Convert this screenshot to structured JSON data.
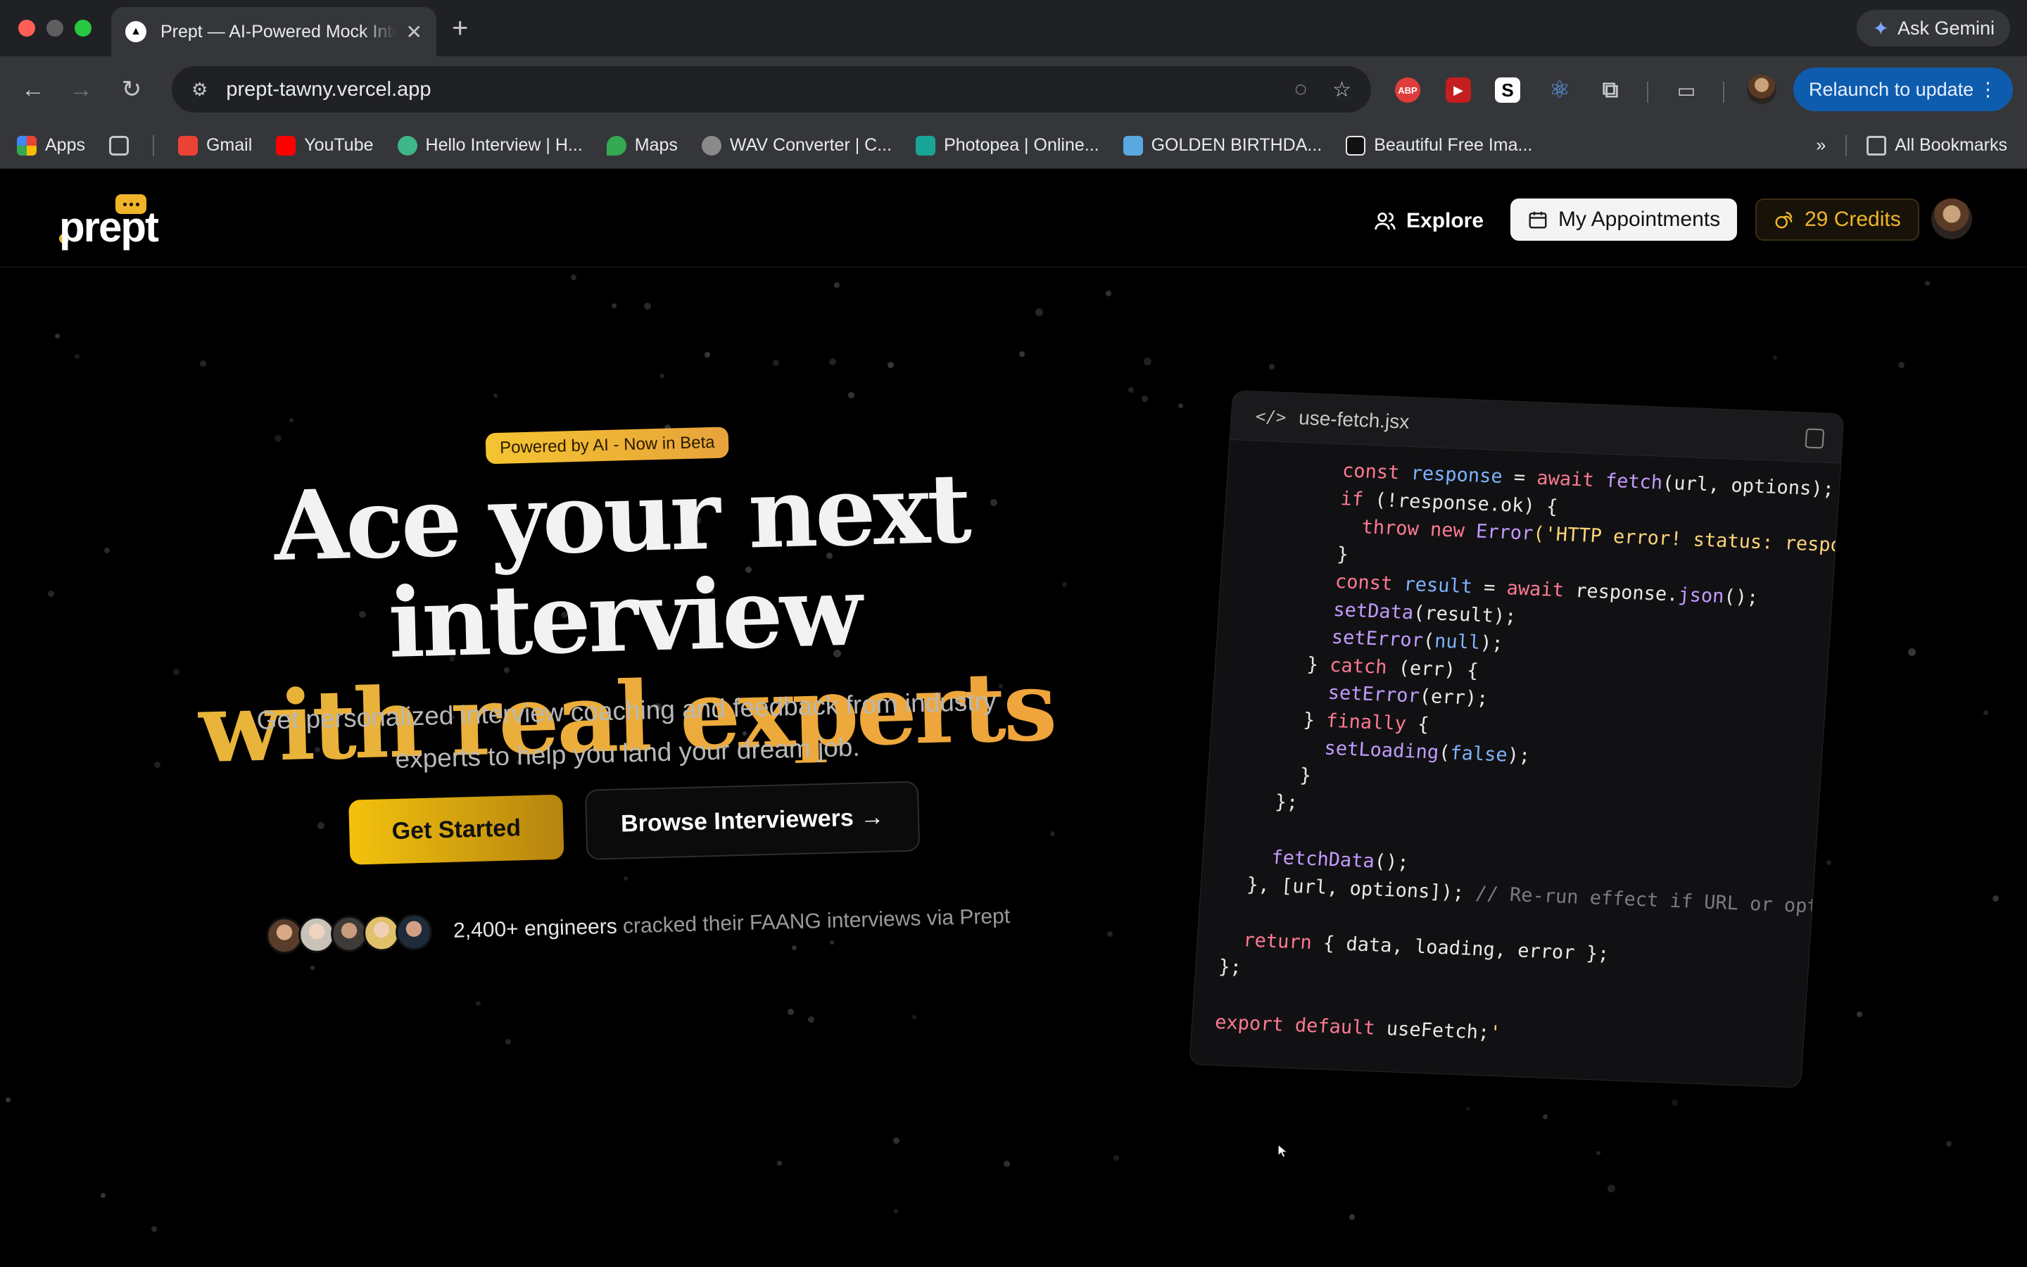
{
  "browser": {
    "tab_title": "Prept — AI-Powered Mock Interviews",
    "url": "prept-tawny.vercel.app",
    "ask_gemini": "Ask Gemini",
    "relaunch": "Relaunch to update",
    "bookmarks": [
      {
        "label": "Apps",
        "color": "#4285f4"
      },
      {
        "label": "Gmail",
        "color": "#ea4335"
      },
      {
        "label": "YouTube",
        "color": "#ff0000"
      },
      {
        "label": "Hello Interview | H...",
        "color": "#3fb58a"
      },
      {
        "label": "Maps",
        "color": "#34a853"
      },
      {
        "label": "WAV Converter | C...",
        "color": "#8a8a8a"
      },
      {
        "label": "Photopea | Online...",
        "color": "#18a497"
      },
      {
        "label": "GOLDEN BIRTHDA...",
        "color": "#5aa8e0"
      },
      {
        "label": "Beautiful Free Ima...",
        "color": "#111111"
      }
    ],
    "all_bookmarks": "All Bookmarks"
  },
  "nav": {
    "logo": "prept",
    "explore": "Explore",
    "appointments": "My Appointments",
    "credits": "29 Credits"
  },
  "hero": {
    "badge": "Powered by AI - Now in Beta",
    "headline_line1": "Ace your next interview",
    "headline_line2": "with real experts",
    "subtitle": "Get personalized interview coaching and feedback from industry experts to help you land your dream job.",
    "cta_primary": "Get Started",
    "cta_secondary": "Browse Interviewers →",
    "proof_strong": "2,400+ engineers",
    "proof_rest": "cracked their FAANG interviews via Prept"
  },
  "code": {
    "filename": "use-fetch.jsx",
    "lines": [
      [
        [
          "        ",
          ""
        ],
        [
          "const ",
          "kw"
        ],
        [
          "response",
          "var"
        ],
        [
          " = ",
          ""
        ],
        [
          "await ",
          "kw"
        ],
        [
          "fetch",
          "fn"
        ],
        [
          "(url, options);",
          ""
        ]
      ],
      [
        [
          "        ",
          ""
        ],
        [
          "if ",
          "kw"
        ],
        [
          "(!response.ok) {",
          ""
        ]
      ],
      [
        [
          "          ",
          ""
        ],
        [
          "throw new ",
          "kw"
        ],
        [
          "Error",
          "fn"
        ],
        [
          "('HTTP error! status: response",
          "str"
        ]
      ],
      [
        [
          "        }",
          ""
        ]
      ],
      [
        [
          "        ",
          ""
        ],
        [
          "const ",
          "kw"
        ],
        [
          "result",
          "var"
        ],
        [
          " = ",
          ""
        ],
        [
          "await ",
          "kw"
        ],
        [
          "response.",
          ""
        ],
        [
          "json",
          "fn"
        ],
        [
          "();",
          ""
        ]
      ],
      [
        [
          "        ",
          ""
        ],
        [
          "setData",
          "fn"
        ],
        [
          "(result);",
          ""
        ]
      ],
      [
        [
          "        ",
          ""
        ],
        [
          "setError",
          "fn"
        ],
        [
          "(",
          ""
        ],
        [
          "null",
          "var"
        ],
        [
          ");",
          ""
        ]
      ],
      [
        [
          "      } ",
          ""
        ],
        [
          "catch ",
          "kw"
        ],
        [
          "(err) {",
          ""
        ]
      ],
      [
        [
          "        ",
          ""
        ],
        [
          "setError",
          "fn"
        ],
        [
          "(err);",
          ""
        ]
      ],
      [
        [
          "      } ",
          ""
        ],
        [
          "finally ",
          "kw"
        ],
        [
          "{",
          ""
        ]
      ],
      [
        [
          "        ",
          ""
        ],
        [
          "setLoading",
          "fn"
        ],
        [
          "(",
          ""
        ],
        [
          "false",
          "var"
        ],
        [
          ");",
          ""
        ]
      ],
      [
        [
          "      }",
          ""
        ]
      ],
      [
        [
          "    };",
          ""
        ]
      ],
      [
        [
          "",
          ""
        ]
      ],
      [
        [
          "    ",
          ""
        ],
        [
          "fetchData",
          "fn"
        ],
        [
          "();",
          ""
        ]
      ],
      [
        [
          "  }, [url, options]); ",
          ""
        ],
        [
          "// Re-run effect if URL or optio",
          "cm"
        ]
      ],
      [
        [
          "",
          ""
        ]
      ],
      [
        [
          "  ",
          ""
        ],
        [
          "return ",
          "kw"
        ],
        [
          "{ data, loading, error };",
          ""
        ]
      ],
      [
        [
          "};",
          ""
        ]
      ],
      [
        [
          "",
          ""
        ]
      ],
      [
        [
          "export default ",
          "kw"
        ],
        [
          "useFetch;",
          ""
        ],
        [
          "'",
          "str"
        ]
      ]
    ]
  }
}
